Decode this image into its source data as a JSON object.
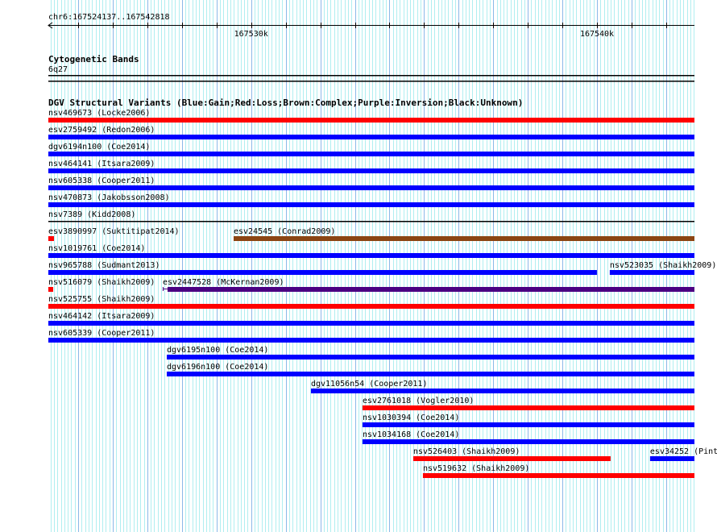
{
  "ruler": {
    "label": "chr6:167524137..167542818",
    "start": 167524137,
    "end": 167542818,
    "tick_labels": [
      {
        "pos": 167530000,
        "text": "167530k"
      },
      {
        "pos": 167540000,
        "text": "167540k"
      }
    ]
  },
  "cytoband": {
    "title": "Cytogenetic Bands",
    "band": "6q27"
  },
  "dgv": {
    "title": "DGV Structural Variants (Blue:Gain;Red:Loss;Brown:Complex;Purple:Inversion;Black:Unknown)",
    "colors": {
      "gain": "#0000ff",
      "loss": "#ff0000",
      "complex": "#8b4513",
      "inversion": "#4b0082",
      "unknown": "#000000"
    },
    "features": [
      {
        "label": "nsv469673 (Locke2006)",
        "type": "loss",
        "start": 167524137,
        "end": 167542818,
        "row": 0
      },
      {
        "label": "esv2759492 (Redon2006)",
        "type": "gain",
        "start": 167524137,
        "end": 167542818,
        "row": 1
      },
      {
        "label": "dgv6194n100 (Coe2014)",
        "type": "gain",
        "start": 167524137,
        "end": 167542818,
        "row": 2
      },
      {
        "label": "nsv464141 (Itsara2009)",
        "type": "gain",
        "start": 167524137,
        "end": 167542818,
        "row": 3
      },
      {
        "label": "nsv605338 (Cooper2011)",
        "type": "gain",
        "start": 167524137,
        "end": 167542818,
        "row": 4
      },
      {
        "label": "nsv470873 (Jakobsson2008)",
        "type": "gain",
        "start": 167524137,
        "end": 167542818,
        "row": 5
      },
      {
        "label": "nsv7389 (Kidd2008)",
        "type": "unknown",
        "start": 167524137,
        "end": 167542818,
        "row": 6
      },
      {
        "label": "esv3890997 (Suktitipat2014)",
        "type": "loss",
        "start": 167524137,
        "end": 167524300,
        "row": 7
      },
      {
        "label": "esv24545 (Conrad2009)",
        "type": "complex",
        "start": 167529494,
        "end": 167542818,
        "row": 7
      },
      {
        "label": "nsv1019761 (Coe2014)",
        "type": "gain",
        "start": 167524137,
        "end": 167542818,
        "row": 8
      },
      {
        "label": "nsv965788 (Sudmant2013)",
        "type": "gain",
        "start": 167524137,
        "end": 167539998,
        "row": 9
      },
      {
        "label": "nsv523035 (Shaikh2009)",
        "type": "gain",
        "start": 167540370,
        "end": 167542818,
        "row": 9
      },
      {
        "label": "nsv516079 (Shaikh2009)",
        "type": "loss",
        "start": 167524137,
        "end": 167524277,
        "row": 10
      },
      {
        "label": "esv2447528 (McKernan2009)",
        "type": "inversion",
        "start": 167527444,
        "end": 167542818,
        "row": 10
      },
      {
        "label": "nsv525755 (Shaikh2009)",
        "type": "loss",
        "start": 167524137,
        "end": 167542818,
        "row": 11
      },
      {
        "label": "nsv464142 (Itsara2009)",
        "type": "gain",
        "start": 167524137,
        "end": 167542818,
        "row": 12
      },
      {
        "label": "nsv605339 (Cooper2011)",
        "type": "gain",
        "start": 167524137,
        "end": 167542818,
        "row": 13
      },
      {
        "label": "dgv6195n100 (Coe2014)",
        "type": "gain",
        "start": 167527561,
        "end": 167542818,
        "row": 14
      },
      {
        "label": "dgv6196n100 (Coe2014)",
        "type": "gain",
        "start": 167527561,
        "end": 167542818,
        "row": 15
      },
      {
        "label": "dgv11056n54 (Cooper2011)",
        "type": "gain",
        "start": 167531730,
        "end": 167542818,
        "row": 16
      },
      {
        "label": "esv2761018 (Vogler2010)",
        "type": "loss",
        "start": 167533220,
        "end": 167542818,
        "row": 17
      },
      {
        "label": "nsv1030394 (Coe2014)",
        "type": "gain",
        "start": 167533220,
        "end": 167542818,
        "row": 18
      },
      {
        "label": "nsv1034168 (Coe2014)",
        "type": "gain",
        "start": 167533220,
        "end": 167542818,
        "row": 19
      },
      {
        "label": "nsv526403 (Shaikh2009)",
        "type": "loss",
        "start": 167534687,
        "end": 167540393,
        "row": 20
      },
      {
        "label": "esv34252 (Pint",
        "type": "gain",
        "start": 167541535,
        "end": 167542818,
        "row": 20
      },
      {
        "label": "nsv519632 (Shaikh2009)",
        "type": "loss",
        "start": 167534967,
        "end": 167542818,
        "row": 21
      }
    ]
  }
}
